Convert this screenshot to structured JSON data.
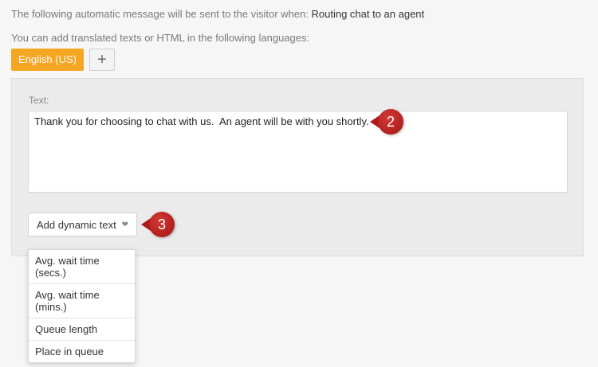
{
  "intro": {
    "prefix": "The following automatic message will be sent to the visitor when:",
    "trigger": "Routing chat to an agent"
  },
  "languages": {
    "hint": "You can add translated texts or HTML in the following languages:",
    "active_tab": "English (US)",
    "add_symbol": "+"
  },
  "editor": {
    "label": "Text:",
    "message": "Thank you for choosing to chat with us.  An agent will be with you shortly."
  },
  "dynamic_text": {
    "button_label": "Add dynamic text",
    "chevron_symbol": "❤",
    "options": [
      "Avg. wait time (secs.)",
      "Avg. wait time (mins.)",
      "Queue length",
      "Place in queue"
    ]
  },
  "markers": {
    "step_2": "2",
    "step_3": "3"
  },
  "colors": {
    "accent": "#f5a623",
    "marker": "#b0191a"
  }
}
